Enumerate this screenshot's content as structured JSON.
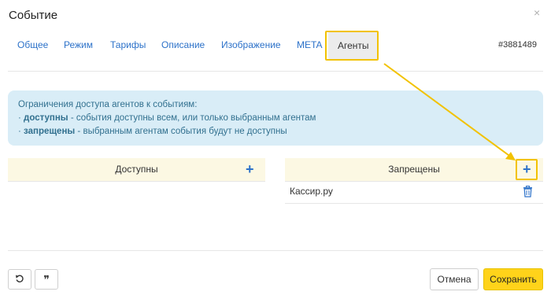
{
  "dialog": {
    "title": "Событие",
    "close_label": "×",
    "event_id": "#3881489"
  },
  "tabs": [
    {
      "label": "Общее"
    },
    {
      "label": "Режим"
    },
    {
      "label": "Тарифы"
    },
    {
      "label": "Описание"
    },
    {
      "label": "Изображение"
    },
    {
      "label": "META"
    },
    {
      "label": "Агенты",
      "active": true
    }
  ],
  "info": {
    "line1": "Ограничения доступа агентов к событиям:",
    "line2_prefix": "· ",
    "line2_bold": "доступны",
    "line2_rest": " - события доступны всем, или только выбранным агентам",
    "line3_prefix": "· ",
    "line3_bold": "запрещены",
    "line3_rest": " - выбранным агентам события будут не доступны"
  },
  "allowed_panel": {
    "title": "Доступны",
    "add_label": "+",
    "items": []
  },
  "forbidden_panel": {
    "title": "Запрещены",
    "add_label": "+",
    "items": [
      {
        "name": "Кассир.ру"
      }
    ]
  },
  "footer": {
    "undo_icon": "undo-icon",
    "quote_label": "❞",
    "cancel_label": "Отмена",
    "save_label": "Сохранить"
  },
  "colors": {
    "accent": "#2d72c9",
    "highlight": "#f2c200",
    "info_bg": "#d9edf7",
    "panel_head_bg": "#fcf8e3",
    "save_bg": "#ffd31a"
  }
}
